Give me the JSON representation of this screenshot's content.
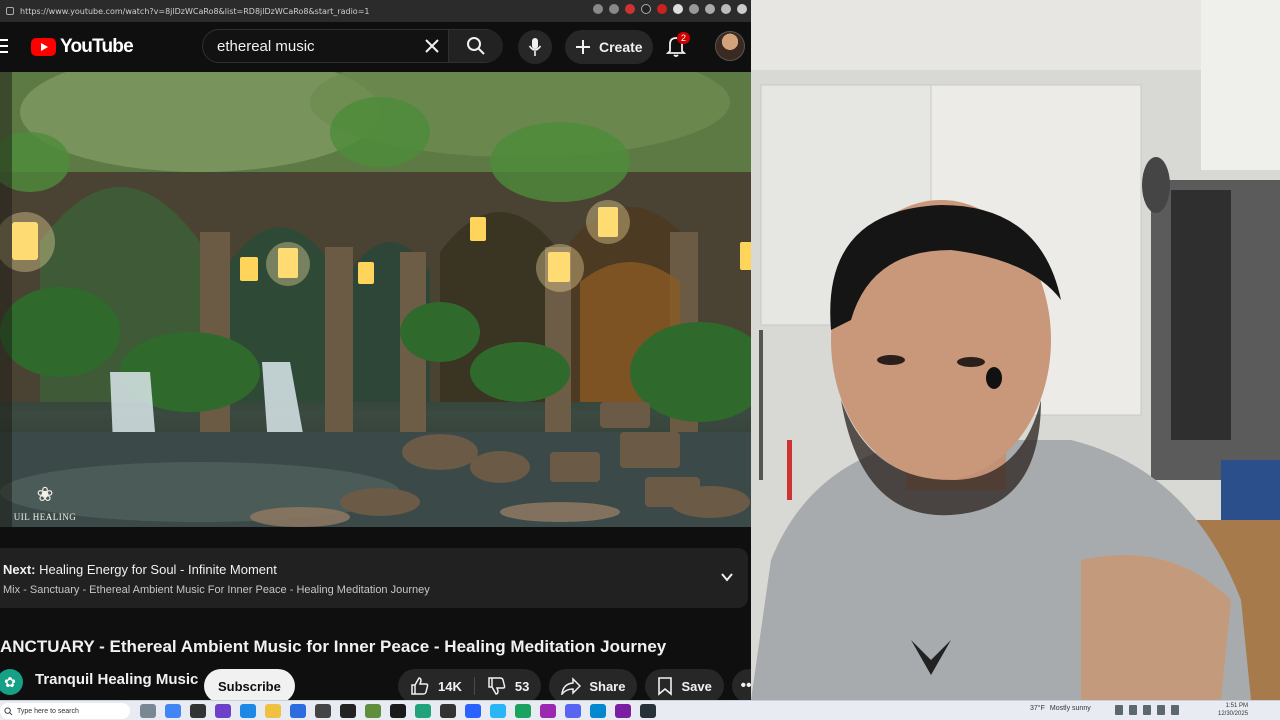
{
  "browser": {
    "url": "https://www.youtube.com/watch?v=8jlDzWCaRo8&list=RD8jlDzWCaRo8&start_radio=1"
  },
  "youtube": {
    "logo_text": "YouTube",
    "search_value": "ethereal music",
    "create_label": "Create",
    "notification_count": "2"
  },
  "video": {
    "watermark_text": "UIL HEALING MUSIC"
  },
  "next_card": {
    "prefix": "Next:",
    "next_title": "Healing Energy for Soul - Infinite Moment",
    "playlist": "Mix - Sanctuary - Ethereal Ambient Music For Inner Peace - Healing Meditation Journey"
  },
  "title": "ANCTUARY - Ethereal Ambient Music for Inner Peace - Healing Meditation Journey",
  "channel": {
    "name": "Tranquil Healing Music",
    "subscribe_label": "Subscribe"
  },
  "actions": {
    "likes": "14K",
    "dislikes": "53",
    "share_label": "Share",
    "save_label": "Save"
  },
  "taskbar": {
    "search_placeholder": "Type here to search",
    "weather_temp": "37°F",
    "weather_desc": "Mostly sunny",
    "time": "1:51 PM",
    "date": "12/30/2025"
  },
  "colors": {
    "youtube_red": "#ff0000",
    "background": "#0f0f0f",
    "pill_bg": "#272727",
    "badge_red": "#cc0000"
  }
}
